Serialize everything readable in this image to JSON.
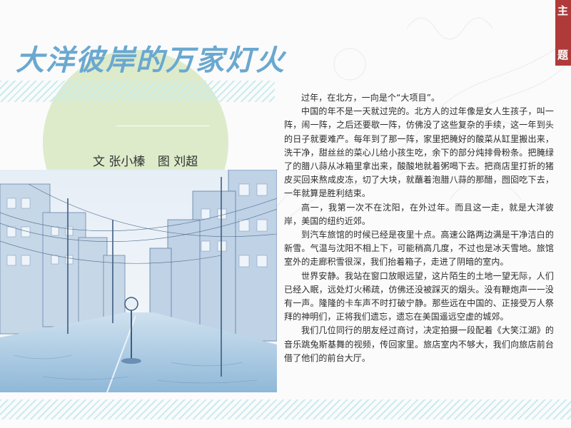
{
  "header": {
    "title": "大洋彼岸的万家灯火",
    "section_tab": [
      "主",
      "题"
    ]
  },
  "byline": {
    "text": "文 张小榛",
    "image": "图 刘超"
  },
  "article": {
    "paragraphs": [
      "过年，在北方，一向是个“大项目”。",
      "中国的年不是一天就过完的。北方人的过年像是女人生孩子，叫一阵，闹一阵，之后还要歇一阵，仿佛没了这些复杂的手续，这一年到头的日子就要难产。每年到了那一阵，家里把腌好的酸菜从缸里搬出来，洗干净，甜丝丝的菜心儿给小孩生吃，余下的部分炖排骨粉条。把腌绿了的腊八蒜从冰箱里拿出来，酸酸地就着粥喝下去。把商店里打折的猪皮买回来熬成皮冻，切了大块，就蘸着泡腊八蒜的那醋，囫囵吃下去，一年就算是胜利结束。",
      "高一，我第一次不在沈阳，在外过年。而且这一走，就是大洋彼岸，美国的纽约近郊。",
      "到汽车旅馆的时候已经是夜里十点。高速公路两边满是干净洁白的新雪。气温与沈阳不相上下，可能稍高几度，不过也是冰天雪地。旅馆室外的走廊积雪很深，我们抬着箱子，走进了阴暗的室内。",
      "世界安静。我站在窗口放眼远望，这片陌生的土地一望无际，人们已经入眠，远处灯火稀疏，仿佛还没被踩灭的烟头。没有鞭炮声一一没有一声。隆隆的卡车声不时打破宁静。那些远在中国的、正接受万人祭拜的神明们，正将我们遗忘，遗忘在美国遥远空虚的城郊。",
      "我们几位同行的朋友经过商讨，决定拍摄一段配着《大笑江湖》的音乐跳兔斯基舞的视频，传回家里。旅店室内不够大，我们向旅店前台借了他们的前台大厅。"
    ]
  },
  "colors": {
    "title": "#6aa8d0",
    "circle": "#d7e8c2",
    "stripe": "#c9ecef",
    "tab": "#b03a3a"
  }
}
